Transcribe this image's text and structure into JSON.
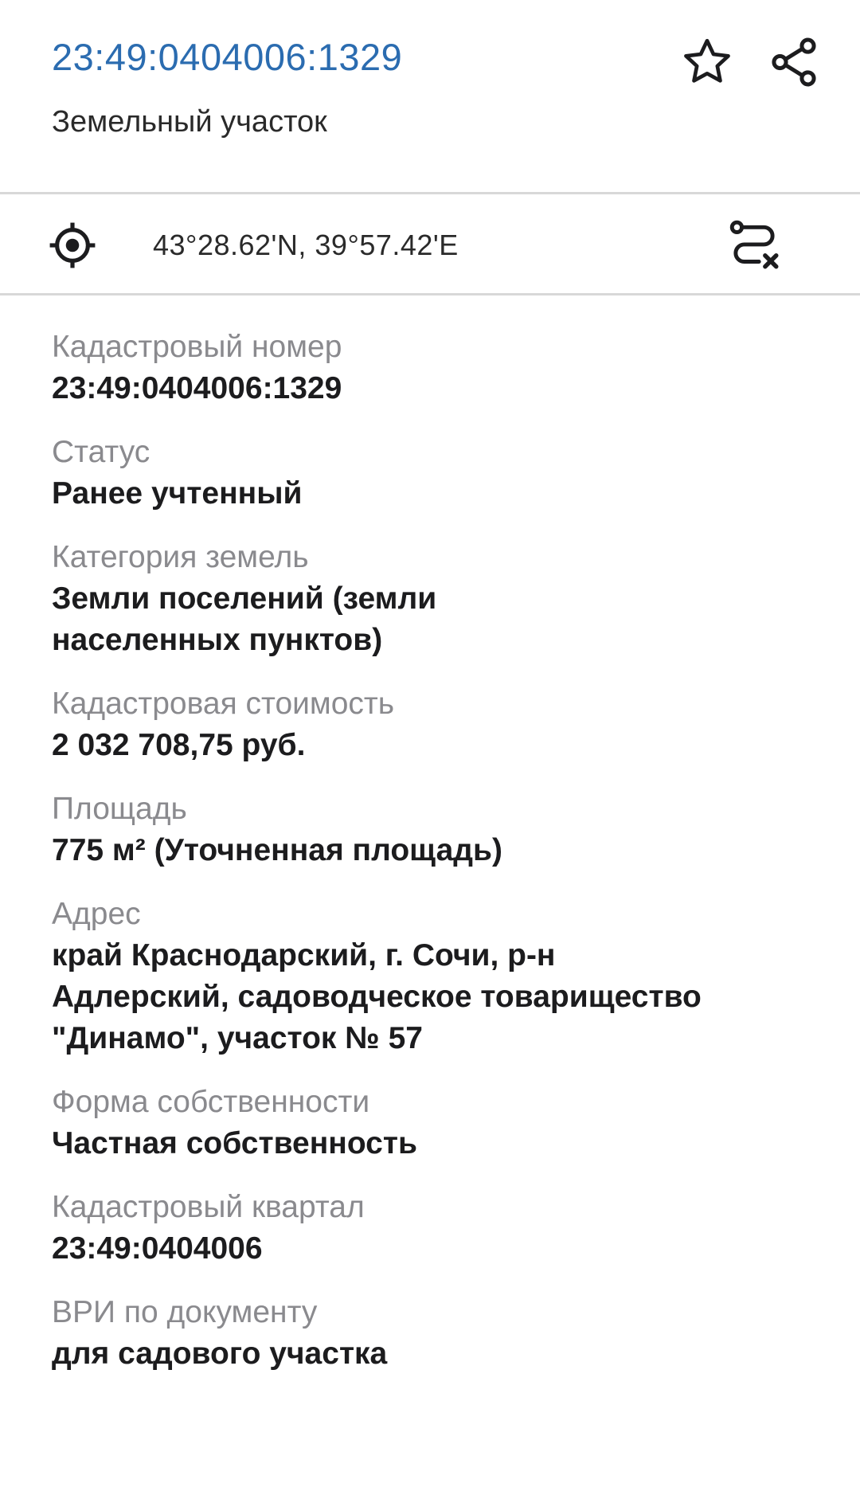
{
  "header": {
    "cadastral_link": "23:49:0404006:1329",
    "object_type": "Земельный участок",
    "favorite_icon": "star-outline-icon",
    "share_icon": "share-icon"
  },
  "location": {
    "coordinates": "43°28.62'N, 39°57.42'E",
    "locate_icon": "crosshair-icon",
    "route_icon": "route-clear-icon"
  },
  "properties": [
    {
      "label": "Кадастровый номер",
      "value": "23:49:0404006:1329"
    },
    {
      "label": "Статус",
      "value": "Ранее учтенный"
    },
    {
      "label": "Категория земель",
      "value": "Земли поселений (земли\nнаселенных пунктов)"
    },
    {
      "label": "Кадастровая стоимость",
      "value": "2 032 708,75 руб."
    },
    {
      "label": "Площадь",
      "value": "775 м² (Уточненная площадь)"
    },
    {
      "label": "Адрес",
      "value": "край Краснодарский, г. Сочи, р-н\nАдлерский, садоводческое товарищество\n\"Динамо\", участок № 57"
    },
    {
      "label": "Форма собственности",
      "value": "Частная собственность"
    },
    {
      "label": "Кадастровый квартал",
      "value": "23:49:0404006"
    },
    {
      "label": "ВРИ по документу",
      "value": "для садового участка"
    }
  ],
  "colors": {
    "link": "#2b6cb0",
    "label": "#8a8a8e",
    "value": "#1c1c1e",
    "divider": "#d8d8d8"
  }
}
